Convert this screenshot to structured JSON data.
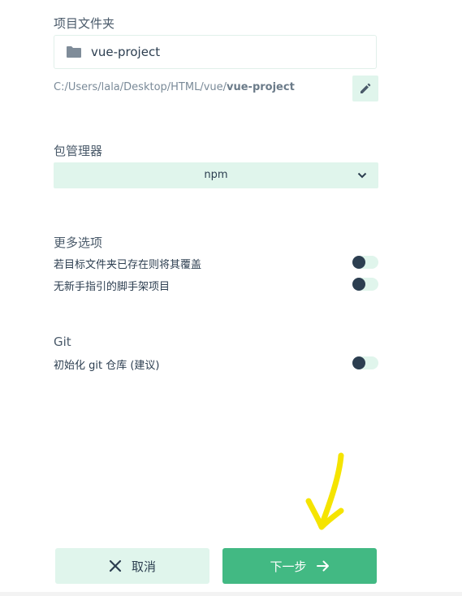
{
  "project_folder": {
    "title": "项目文件夹",
    "value": "vue-project",
    "path_prefix": "C:/Users/lala/Desktop/HTML/vue/",
    "path_name": "vue-project"
  },
  "package_manager": {
    "title": "包管理器",
    "selected": "npm"
  },
  "more_options": {
    "title": "更多选项",
    "items": [
      {
        "label": "若目标文件夹已存在则将其覆盖",
        "enabled": false
      },
      {
        "label": "无新手指引的脚手架项目",
        "enabled": false
      }
    ]
  },
  "git": {
    "title": "Git",
    "init_label": "初始化 git 仓库 (建议)",
    "enabled": false
  },
  "footer": {
    "cancel_label": "取消",
    "next_label": "下一步"
  },
  "icons": [
    "folder-icon",
    "pencil-icon",
    "chevron-down-icon",
    "close-icon",
    "arrow-right-icon"
  ],
  "colors": {
    "accent": "#42b983",
    "light_accent": "#e0f5ec",
    "dark": "#2c3e50",
    "annotation": "#f5e400"
  }
}
